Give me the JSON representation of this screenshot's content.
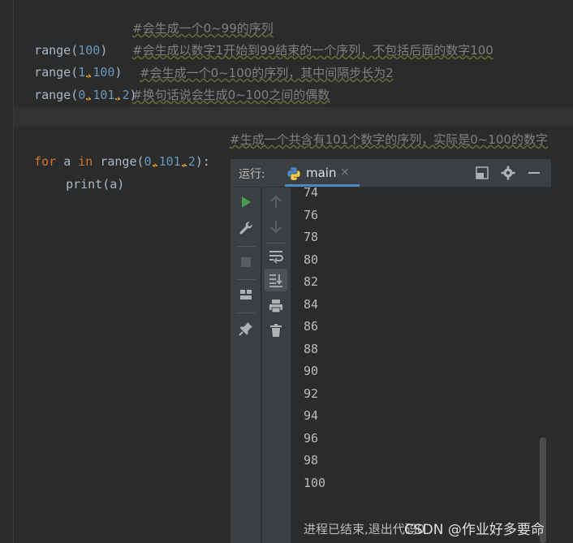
{
  "editor": {
    "lines": [
      {
        "code_fn": "range",
        "code_open": "(",
        "code_n1": "100",
        "code_close": ")",
        "comment": "#会生成一个0~99的序列"
      },
      {
        "code_fn": "range",
        "code_open": "(",
        "code_n1": "1",
        "code_comma1": ",",
        "code_n2": "100",
        "code_close": ")",
        "comment": "#会生成以数字1开始到99结束的一个序列，不包括后面的数字100"
      },
      {
        "code_fn": "range",
        "code_open": "(",
        "code_n1": "0",
        "code_comma1": ",",
        "code_n2": "101",
        "code_comma2": ",",
        "code_n3": "2",
        "code_close": ")",
        "comment": "#会生成一个0~100的序列，其中间隔步长为2"
      },
      {
        "comment": "#换句话说会生成0~100之间的偶数"
      }
    ],
    "for_line": {
      "kw_for": "for",
      "var": "a",
      "kw_in": "in",
      "fn": "range",
      "open": "(",
      "n1": "0",
      "c1": ",",
      "n2": "101",
      "c2": ",",
      "n3": "2",
      "close": "):",
      "comment": "#生成一个共含有101个数字的序列，实际是0~100的数字"
    },
    "print_line": {
      "fn": "print",
      "arg": "(a)"
    }
  },
  "run_panel": {
    "title": "运行:",
    "tab_label": "main",
    "tab_close": "×",
    "output": [
      "74",
      "76",
      "78",
      "80",
      "82",
      "84",
      "86",
      "88",
      "90",
      "92",
      "94",
      "96",
      "98",
      "100"
    ],
    "exit_message": "进程已结束,退出代码0"
  },
  "watermark": "CSDN @作业好多要命",
  "colors": {
    "accent": "#4a88c7",
    "run_green": "#499c54",
    "keyword": "#cc7832",
    "number": "#6897bb",
    "comment": "#808080"
  }
}
